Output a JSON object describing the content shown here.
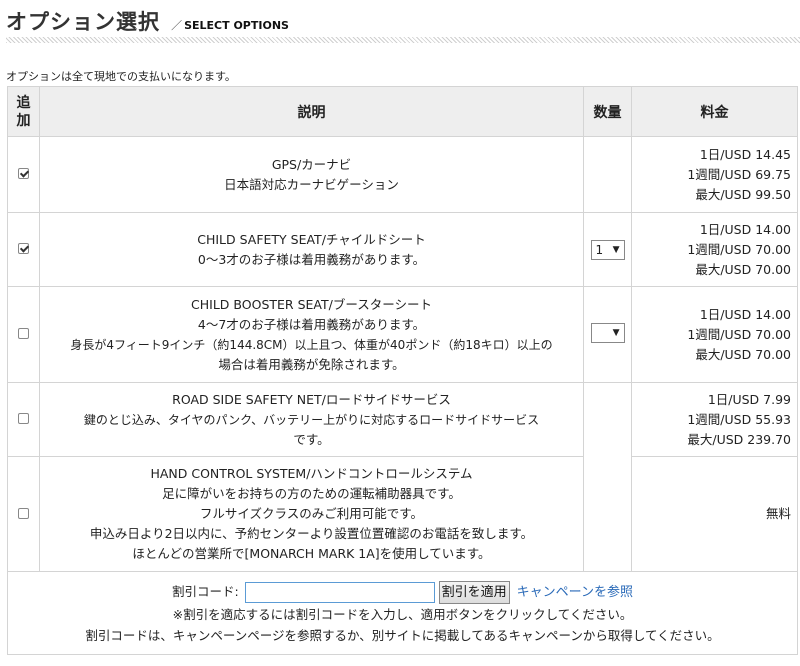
{
  "header": {
    "title": "オプション選択",
    "subtitle_slash": "／",
    "subtitle": "SELECT OPTIONS"
  },
  "note": "オプションは全て現地での支払いになります。",
  "table": {
    "headers": {
      "add": "追加",
      "description": "説明",
      "quantity": "数量",
      "price": "料金"
    },
    "rows": [
      {
        "checked": true,
        "lines": [
          "GPS/カーナビ",
          "日本語対応カーナビゲーション"
        ],
        "quantity": null,
        "prices": [
          "1日/USD 14.45",
          "1週間/USD 69.75",
          "最大/USD 99.50"
        ]
      },
      {
        "checked": true,
        "lines": [
          "CHILD SAFETY SEAT/チャイルドシート",
          "0〜3才のお子様は着用義務があります。"
        ],
        "quantity": "1",
        "prices": [
          "1日/USD 14.00",
          "1週間/USD 70.00",
          "最大/USD 70.00"
        ]
      },
      {
        "checked": false,
        "lines": [
          "CHILD BOOSTER SEAT/ブースターシート",
          "4〜7才のお子様は着用義務があります。",
          "身長が4フィート9インチ（約144.8CM）以上且つ、体重が40ポンド（約18キロ）以上の",
          "場合は着用義務が免除されます。"
        ],
        "quantity": "",
        "prices": [
          "1日/USD 14.00",
          "1週間/USD 70.00",
          "最大/USD 70.00"
        ]
      },
      {
        "checked": false,
        "lines": [
          "ROAD SIDE SAFETY NET/ロードサイドサービス",
          "鍵のとじ込み、タイヤのパンク、バッテリー上がりに対応するロードサイドサービス",
          "です。"
        ],
        "quantity": null,
        "prices": [
          "1日/USD 7.99",
          "1週間/USD 55.93",
          "最大/USD 239.70"
        ]
      },
      {
        "checked": false,
        "lines": [
          "HAND CONTROL SYSTEM/ハンドコントロールシステム",
          "足に障がいをお持ちの方のための運転補助器具です。",
          "フルサイズクラスのみご利用可能です。",
          "申込み日より2日以内に、予約センターより設置位置確認のお電話を致します。",
          "ほとんどの営業所で[MONARCH MARK 1A]を使用しています。"
        ],
        "quantity": null,
        "prices": [
          "無料"
        ]
      }
    ]
  },
  "discount": {
    "label": "割引コード:",
    "input_value": "",
    "apply_button": "割引を適用",
    "campaign_link": "キャンペーンを参照",
    "note1": "※割引を適応するには割引コードを入力し、適用ボタンをクリックしてください。",
    "note2": "割引コードは、キャンペーンページを参照するか、別サイトに掲載してあるキャンペーンから取得してください。"
  },
  "colors": {
    "header_bg": "#eeeeee",
    "border": "#d4d4d4",
    "link": "#2a6ab8"
  }
}
